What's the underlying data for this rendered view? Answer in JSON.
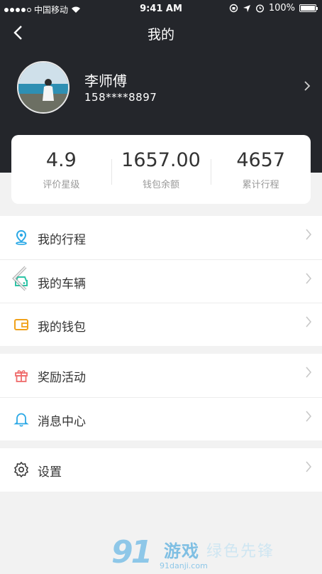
{
  "status_bar": {
    "carrier": "中国移动",
    "time": "9:41 AM",
    "battery": "100%"
  },
  "nav": {
    "title": "我的"
  },
  "profile": {
    "name": "李师傅",
    "phone": "158****8897"
  },
  "stats": [
    {
      "value": "4.9",
      "label": "评价星级"
    },
    {
      "value": "1657.00",
      "label": "钱包余额"
    },
    {
      "value": "4657",
      "label": "累计行程"
    }
  ],
  "menu_groups": [
    [
      {
        "label": "我的行程",
        "icon": "location-pin-icon",
        "color": "#2aa8e6"
      },
      {
        "label": "我的车辆",
        "icon": "car-icon",
        "color": "#2ec4a6"
      },
      {
        "label": "我的钱包",
        "icon": "wallet-icon",
        "color": "#f0a21b"
      }
    ],
    [
      {
        "label": "奖励活动",
        "icon": "gift-icon",
        "color": "#ef6b6b"
      },
      {
        "label": "消息中心",
        "icon": "bell-icon",
        "color": "#2aa8e6"
      }
    ],
    [
      {
        "label": "设置",
        "icon": "gear-icon",
        "color": "#333333"
      }
    ]
  ],
  "watermark": {
    "logo": "91",
    "text": "游戏",
    "url": "91danji.com",
    "sub": "绿色先锋"
  },
  "colors": {
    "header_bg": "#24262b",
    "page_bg": "#f2f2f2"
  }
}
